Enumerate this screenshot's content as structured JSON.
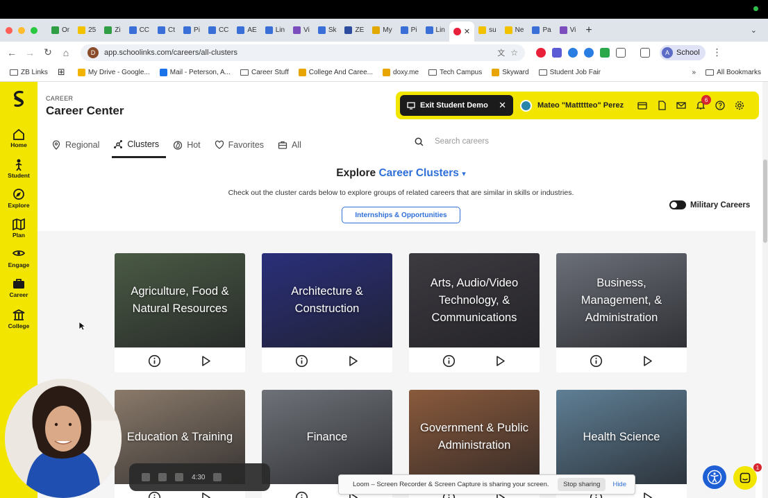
{
  "browser": {
    "tabs": [
      {
        "label": "Or",
        "color": "#2f9e44"
      },
      {
        "label": "25",
        "color": "#f2c200"
      },
      {
        "label": "Zi",
        "color": "#2f9e44"
      },
      {
        "label": "CC",
        "color": "#3a6fd8"
      },
      {
        "label": "Ct",
        "color": "#3a6fd8"
      },
      {
        "label": "Pi",
        "color": "#3a6fd8"
      },
      {
        "label": "CC",
        "color": "#3a6fd8"
      },
      {
        "label": "AE",
        "color": "#3a6fd8"
      },
      {
        "label": "Lin",
        "color": "#3a6fd8"
      },
      {
        "label": "Vi",
        "color": "#7c4dbd"
      },
      {
        "label": "Sk",
        "color": "#3a6fd8"
      },
      {
        "label": "ZE",
        "color": "#2b4c9e"
      },
      {
        "label": "My",
        "color": "#e0a800"
      },
      {
        "label": "Pi",
        "color": "#3a6fd8"
      },
      {
        "label": "Lin",
        "color": "#3a6fd8"
      },
      {
        "label": "su",
        "color": "#f2c200"
      },
      {
        "label": "Ne",
        "color": "#f2c200"
      },
      {
        "label": "Pa",
        "color": "#3a6fd8"
      },
      {
        "label": "Vi",
        "color": "#7c4dbd"
      }
    ],
    "url": "app.schoolinks.com/careers/all-clusters",
    "profile_label": "School",
    "profile_initial": "A",
    "site_initial": "D",
    "bookmarks": [
      {
        "label": "ZB Links",
        "kind": "folder"
      },
      {
        "label": "",
        "kind": "apps"
      },
      {
        "label": "My Drive - Google...",
        "kind": "drive"
      },
      {
        "label": "Mail - Peterson, A...",
        "kind": "mail"
      },
      {
        "label": "Career Stuff",
        "kind": "folder"
      },
      {
        "label": "College And Caree...",
        "kind": "site"
      },
      {
        "label": "doxy.me",
        "kind": "site"
      },
      {
        "label": "Tech Campus",
        "kind": "folder"
      },
      {
        "label": "Skyward",
        "kind": "site"
      },
      {
        "label": "Student Job Fair",
        "kind": "folder"
      }
    ],
    "bookmarks_more": "»",
    "all_bookmarks": "All Bookmarks"
  },
  "sidebar": {
    "items": [
      {
        "label": "Home",
        "icon": "home-icon"
      },
      {
        "label": "Student",
        "icon": "student-icon"
      },
      {
        "label": "Explore",
        "icon": "compass-icon"
      },
      {
        "label": "Plan",
        "icon": "map-icon"
      },
      {
        "label": "Engage",
        "icon": "engage-icon"
      },
      {
        "label": "Career",
        "icon": "briefcase-icon"
      },
      {
        "label": "College",
        "icon": "college-icon"
      }
    ]
  },
  "header": {
    "breadcrumb": "CAREER",
    "title": "Career Center",
    "exit_demo": "Exit Student Demo",
    "student_name": "Mateo \"Mattttteo\" Perez",
    "notification_count": "6"
  },
  "tabs": [
    {
      "label": "Regional",
      "icon": "location-icon",
      "selected": false
    },
    {
      "label": "Clusters",
      "icon": "clusters-icon",
      "selected": true
    },
    {
      "label": "Hot",
      "icon": "flame-icon",
      "selected": false
    },
    {
      "label": "Favorites",
      "icon": "heart-icon",
      "selected": false
    },
    {
      "label": "All",
      "icon": "briefcase-icon",
      "selected": false
    }
  ],
  "search": {
    "placeholder": "Search careers"
  },
  "explore": {
    "prefix": "Explore",
    "highlight": "Career Clusters",
    "caret": "▾",
    "description": "Check out the cluster cards below to explore groups of related careers that are similar in skills or industries.",
    "internships_button": "Internships & Opportunities",
    "military_toggle": "Military Careers"
  },
  "clusters": [
    {
      "name": "Agriculture, Food & Natural Resources",
      "bg": "#4a5a44"
    },
    {
      "name": "Architecture & Construction",
      "bg": "#2a2f7a"
    },
    {
      "name": "Arts, Audio/Video Technology, & Communications",
      "bg": "#3d3a40"
    },
    {
      "name": "Business, Management, & Administration",
      "bg": "#6b6f78"
    },
    {
      "name": "Education & Training",
      "bg": "#8a7a6a"
    },
    {
      "name": "Finance",
      "bg": "#6e7278"
    },
    {
      "name": "Government & Public Administration",
      "bg": "#8a5a3c"
    },
    {
      "name": "Health Science",
      "bg": "#5f7f95"
    }
  ],
  "recorder": {
    "time": "4:30"
  },
  "loom": {
    "message": "Loom – Screen Recorder & Screen Capture is sharing your screen.",
    "stop": "Stop sharing",
    "hide": "Hide"
  },
  "chat_badge": "1",
  "colors": {
    "brand_yellow": "#f2e600",
    "accent_blue": "#2e6fd8",
    "badge_red": "#d8262f"
  }
}
